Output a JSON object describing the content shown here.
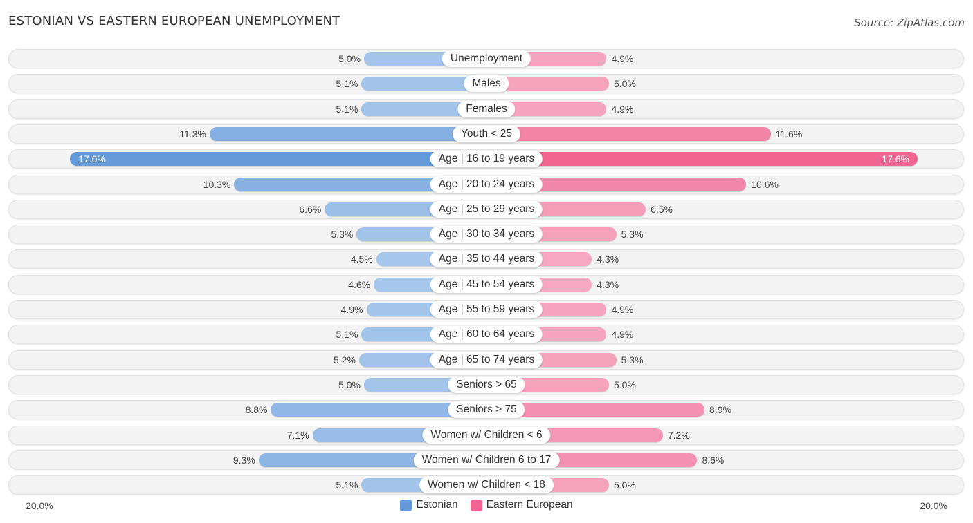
{
  "header": {
    "title": "ESTONIAN VS EASTERN EUROPEAN UNEMPLOYMENT",
    "source": "Source: ZipAtlas.com"
  },
  "colors": {
    "estonian_light": "#a9c8ec",
    "estonian_strong": "#6399d9",
    "eastern_light": "#f6a8c2",
    "eastern_strong": "#f06592"
  },
  "chart_data": {
    "type": "bar",
    "orientation": "horizontal-diverging",
    "title": "ESTONIAN VS EASTERN EUROPEAN UNEMPLOYMENT",
    "categories": [
      "Unemployment",
      "Males",
      "Females",
      "Youth < 25",
      "Age | 16 to 19 years",
      "Age | 20 to 24 years",
      "Age | 25 to 29 years",
      "Age | 30 to 34 years",
      "Age | 35 to 44 years",
      "Age | 45 to 54 years",
      "Age | 55 to 59 years",
      "Age | 60 to 64 years",
      "Age | 65 to 74 years",
      "Seniors > 65",
      "Seniors > 75",
      "Women w/ Children < 6",
      "Women w/ Children 6 to 17",
      "Women w/ Children < 18"
    ],
    "series": [
      {
        "name": "Estonian",
        "side": "left",
        "values": [
          5.0,
          5.1,
          5.1,
          11.3,
          17.0,
          10.3,
          6.6,
          5.3,
          4.5,
          4.6,
          4.9,
          5.1,
          5.2,
          5.0,
          8.8,
          7.1,
          9.3,
          5.1
        ],
        "labels": [
          "5.0%",
          "5.1%",
          "5.1%",
          "11.3%",
          "17.0%",
          "10.3%",
          "6.6%",
          "5.3%",
          "4.5%",
          "4.6%",
          "4.9%",
          "5.1%",
          "5.2%",
          "5.0%",
          "8.8%",
          "7.1%",
          "9.3%",
          "5.1%"
        ]
      },
      {
        "name": "Eastern European",
        "side": "right",
        "values": [
          4.9,
          5.0,
          4.9,
          11.6,
          17.6,
          10.6,
          6.5,
          5.3,
          4.3,
          4.3,
          4.9,
          4.9,
          5.3,
          5.0,
          8.9,
          7.2,
          8.6,
          5.0
        ],
        "labels": [
          "4.9%",
          "5.0%",
          "4.9%",
          "11.6%",
          "17.6%",
          "10.6%",
          "6.5%",
          "5.3%",
          "4.3%",
          "4.3%",
          "4.9%",
          "4.9%",
          "5.3%",
          "5.0%",
          "8.9%",
          "7.2%",
          "8.6%",
          "5.0%"
        ]
      }
    ],
    "axis": {
      "min_label": "20.0%",
      "max_label": "20.0%",
      "range": [
        -20,
        20
      ]
    },
    "unit": "%",
    "legend": {
      "position": "bottom-center",
      "entries": [
        "Estonian",
        "Eastern European"
      ]
    }
  }
}
